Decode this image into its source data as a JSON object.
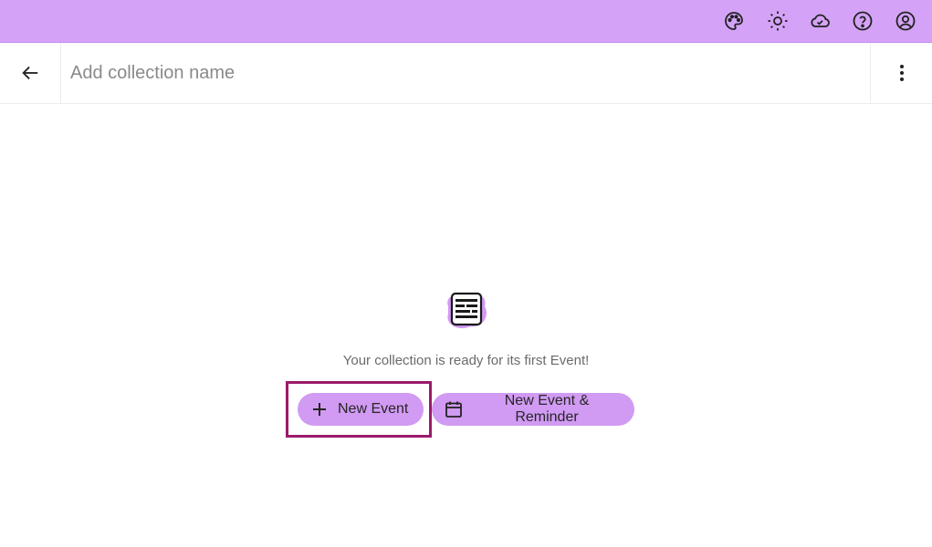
{
  "topbar": {
    "background": "#d4a3f7",
    "icons": [
      "palette-icon",
      "sun-icon",
      "cloud-check-icon",
      "help-icon",
      "account-icon"
    ]
  },
  "header": {
    "name_placeholder": "Add collection name",
    "name_value": ""
  },
  "empty_state": {
    "message": "Your collection is ready for its first Event!"
  },
  "buttons": {
    "new_event": "New Event",
    "new_event_reminder": "New Event & Reminder"
  },
  "colors": {
    "accent": "#d19af3",
    "highlight": "#9b1a6b"
  }
}
